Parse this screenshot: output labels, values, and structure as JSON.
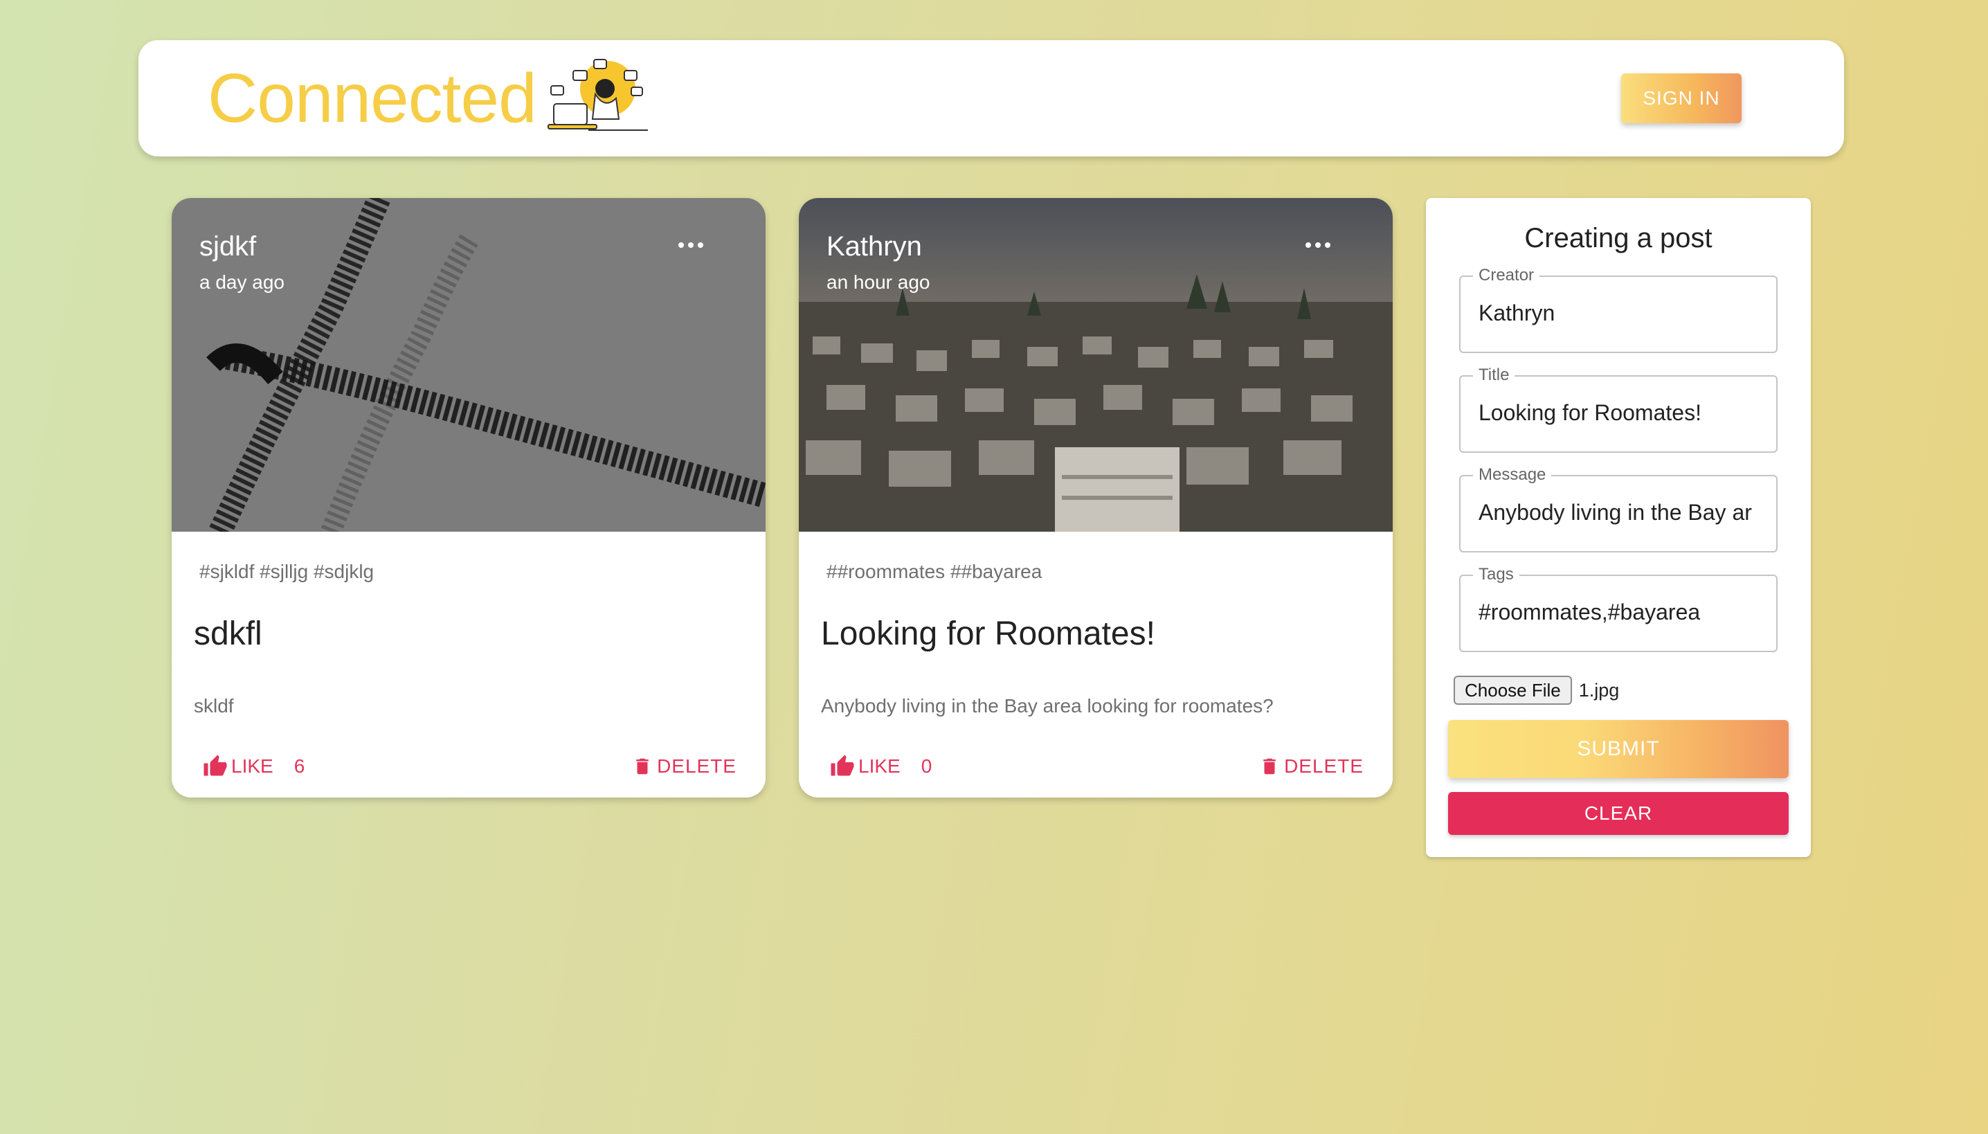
{
  "header": {
    "brand": "Connected",
    "logo_icon": "person-at-laptop-illustration",
    "sign_in_label": "SIGN IN",
    "brand_color": "#f6cd47"
  },
  "posts": [
    {
      "creator": "sjdkf",
      "time": "a day ago",
      "tags": "#sjkldf #sjlljg #sdjklg",
      "title": "sdkfl",
      "message": "skldf",
      "like_label": "LIKE",
      "like_count": "6",
      "delete_label": "DELETE",
      "image": "abstract-brush-strokes"
    },
    {
      "creator": "Kathryn",
      "time": "an hour ago",
      "tags": "##roommates ##bayarea",
      "title": "Looking for Roomates!",
      "message": "Anybody living in the Bay area looking for roomates?",
      "like_label": "LIKE",
      "like_count": "0",
      "delete_label": "DELETE",
      "image": "city-neighborhood-aerial"
    }
  ],
  "form": {
    "heading": "Creating a post",
    "creator": {
      "label": "Creator",
      "value": "Kathryn"
    },
    "title": {
      "label": "Title",
      "value": "Looking for Roomates!"
    },
    "message": {
      "label": "Message",
      "value": "Anybody living in the Bay ar"
    },
    "tags": {
      "label": "Tags",
      "value": "#roommates,#bayarea"
    },
    "choose_file_label": "Choose File",
    "file_name": "1.jpg",
    "submit_label": "SUBMIT",
    "clear_label": "CLEAR"
  },
  "colors": {
    "accent_red": "#e2345a",
    "clear_button": "#e42d58"
  }
}
